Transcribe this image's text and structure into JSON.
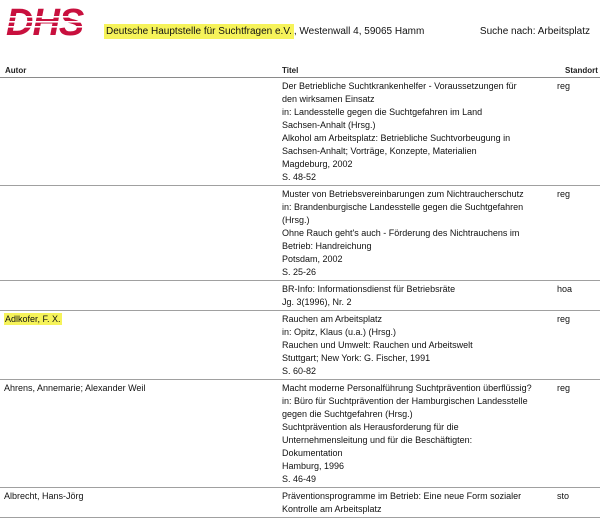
{
  "header": {
    "org_name": "Deutsche Hauptstelle für Suchtfragen e.V.",
    "address": ", Westenwall 4, 59065 Hamm",
    "search_label": "Suche nach:",
    "search_value": "Arbeitsplatz",
    "logo_text": "DHS",
    "logo_color": "#c8103e"
  },
  "columns": {
    "author": "Autor",
    "title": "Titel",
    "standort": "Standort"
  },
  "highlight_color": "#f6f35a",
  "rows": [
    {
      "author": "",
      "author_highlight": false,
      "title_lines": [
        "Der Betriebliche Suchtkrankenhelfer - Voraussetzungen für",
        "den wirksamen Einsatz",
        "in: Landesstelle gegen die Suchtgefahren im Land",
        "Sachsen-Anhalt (Hrsg.)",
        "Alkohol am Arbeitsplatz: Betriebliche Suchtvorbeugung in",
        "Sachsen-Anhalt; Vorträge, Konzepte, Materialien",
        "Magdeburg, 2002",
        "S. 48-52"
      ],
      "standort": "reg"
    },
    {
      "author": "",
      "author_highlight": false,
      "title_lines": [
        "Muster von Betriebsvereinbarungen zum Nichtraucherschutz",
        "in: Brandenburgische Landesstelle gegen die Suchtgefahren",
        "(Hrsg.)",
        "Ohne Rauch geht's auch - Förderung des Nichtrauchens im",
        "Betrieb: Handreichung",
        "Potsdam, 2002",
        "S. 25-26"
      ],
      "standort": "reg"
    },
    {
      "author": "",
      "author_highlight": false,
      "title_lines": [
        "BR-Info: Informationsdienst für Betriebsräte",
        "Jg. 3(1996), Nr. 2"
      ],
      "standort": "hoa"
    },
    {
      "author": "Adlkofer, F. X.",
      "author_highlight": true,
      "title_lines": [
        "Rauchen am Arbeitsplatz",
        "in: Opitz, Klaus (u.a.) (Hrsg.)",
        "Rauchen und Umwelt: Rauchen und Arbeitswelt",
        "Stuttgart; New York: G. Fischer, 1991",
        "S. 60-82"
      ],
      "standort": "reg"
    },
    {
      "author": "Ahrens, Annemarie; Alexander Weil",
      "author_highlight": false,
      "title_lines": [
        "Macht moderne Personalführung Suchtprävention überflüssig?",
        "in: Büro für Suchtprävention der Hamburgischen Landesstelle",
        "gegen die Suchtgefahren (Hrsg.)",
        "Suchtprävention als Herausforderung für die",
        "Unternehmensleitung und für die Beschäftigten:",
        "Dokumentation",
        "Hamburg, 1996",
        "S. 46-49"
      ],
      "standort": "reg"
    },
    {
      "author": "Albrecht, Hans-Jörg",
      "author_highlight": false,
      "title_lines": [
        "Präventionsprogramme im Betrieb: Eine neue Form sozialer",
        "Kontrolle am Arbeitsplatz"
      ],
      "standort": "sto"
    }
  ]
}
